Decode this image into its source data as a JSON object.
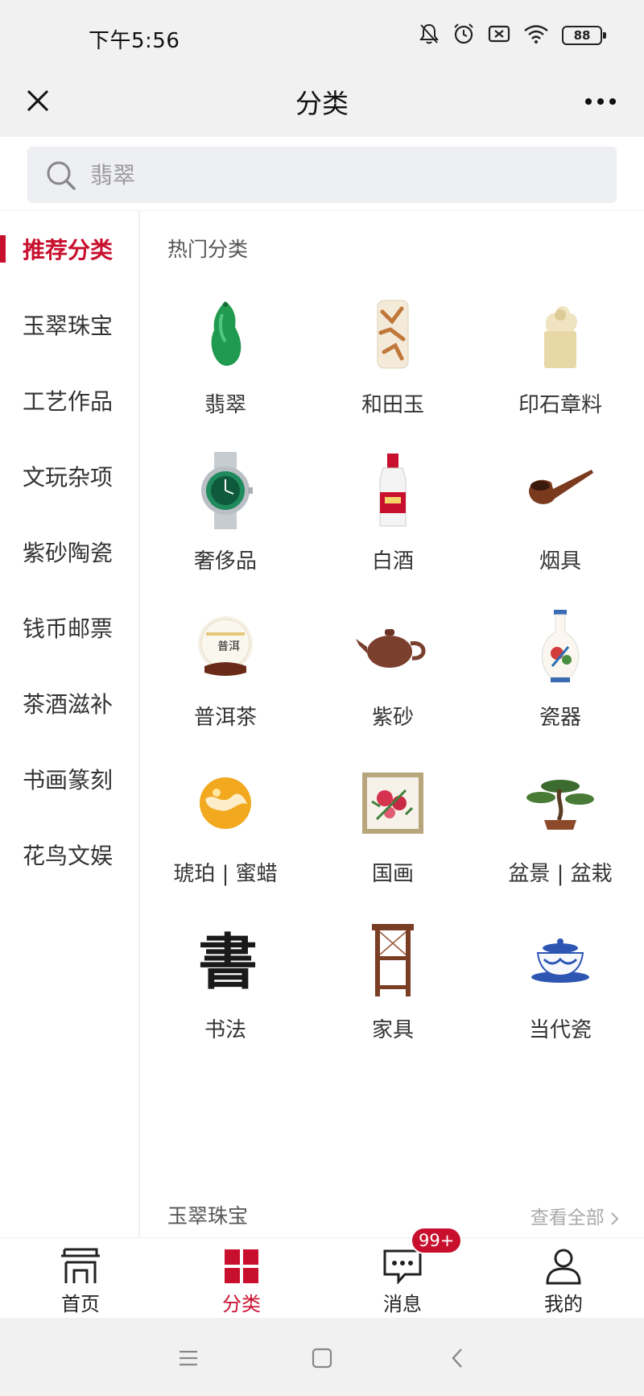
{
  "status": {
    "time": "下午5:56",
    "battery": "88"
  },
  "header": {
    "title": "分类"
  },
  "search": {
    "placeholder": "翡翠"
  },
  "sidebar": {
    "items": [
      {
        "label": "推荐分类",
        "active": true
      },
      {
        "label": "玉翠珠宝"
      },
      {
        "label": "工艺作品"
      },
      {
        "label": "文玩杂项"
      },
      {
        "label": "紫砂陶瓷"
      },
      {
        "label": "钱币邮票"
      },
      {
        "label": "茶酒滋补"
      },
      {
        "label": "书画篆刻"
      },
      {
        "label": "花鸟文娱"
      }
    ]
  },
  "main": {
    "hot_title": "热门分类",
    "categories": [
      {
        "label": "翡翠",
        "icon": "jade-pendant-icon"
      },
      {
        "label": "和田玉",
        "icon": "hetian-jade-icon"
      },
      {
        "label": "印石章料",
        "icon": "seal-stone-icon"
      },
      {
        "label": "奢侈品",
        "icon": "watch-icon"
      },
      {
        "label": "白酒",
        "icon": "liquor-bottle-icon"
      },
      {
        "label": "烟具",
        "icon": "pipe-icon"
      },
      {
        "label": "普洱茶",
        "icon": "puer-tea-cake-icon"
      },
      {
        "label": "紫砂",
        "icon": "teapot-icon"
      },
      {
        "label": "瓷器",
        "icon": "porcelain-vase-icon"
      },
      {
        "label": "琥珀 | 蜜蜡",
        "icon": "amber-icon"
      },
      {
        "label": "国画",
        "icon": "painting-icon"
      },
      {
        "label": "盆景 | 盆栽",
        "icon": "bonsai-icon"
      },
      {
        "label": "书法",
        "icon": "calligraphy-icon"
      },
      {
        "label": "家具",
        "icon": "furniture-icon"
      },
      {
        "label": "当代瓷",
        "icon": "tea-bowl-icon"
      }
    ],
    "calligraphy_char": "書",
    "puer_text": "普洱",
    "next_section_title": "玉翠珠宝",
    "view_all": "查看全部"
  },
  "bottom_nav": {
    "items": [
      {
        "label": "首页",
        "icon": "home-icon"
      },
      {
        "label": "分类",
        "icon": "category-icon",
        "active": true
      },
      {
        "label": "消息",
        "icon": "message-icon",
        "badge": "99+"
      },
      {
        "label": "我的",
        "icon": "profile-icon"
      }
    ]
  },
  "colors": {
    "accent": "#c8102e",
    "header_bg": "#f1f1f1",
    "search_bg": "#eeeff3"
  }
}
